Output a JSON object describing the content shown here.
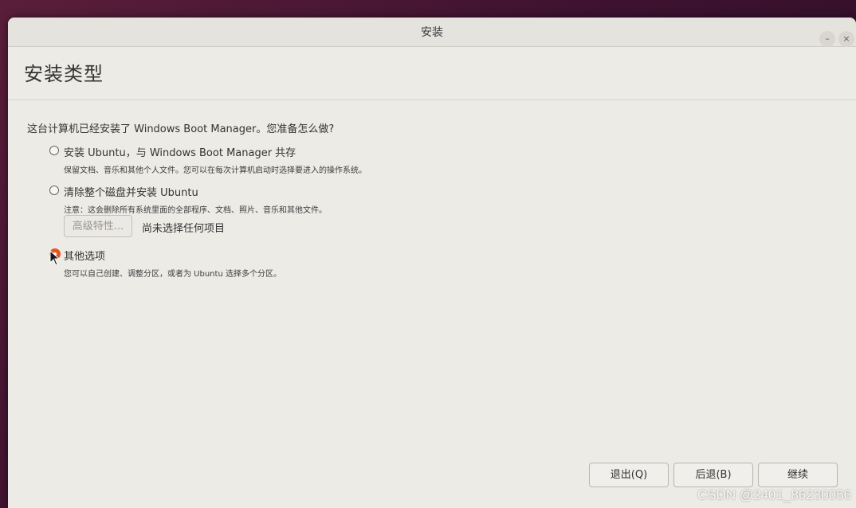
{
  "window": {
    "title": "安装",
    "minimize_glyph": "–",
    "close_glyph": "×"
  },
  "header": {
    "title": "安装类型"
  },
  "question": "这台计算机已经安装了 Windows Boot Manager。您准备怎么做?",
  "options": [
    {
      "label": "安装 Ubuntu，与 Windows Boot Manager 共存",
      "description": "保留文档、音乐和其他个人文件。您可以在每次计算机启动时选择要进入的操作系统。",
      "selected": false
    },
    {
      "label": "清除整个磁盘并安装 Ubuntu",
      "description": "注意：这会删除所有系统里面的全部程序、文档、照片、音乐和其他文件。",
      "selected": false
    },
    {
      "label": "其他选项",
      "description": "您可以自己创建、调整分区，或者为 Ubuntu 选择多个分区。",
      "selected": true
    }
  ],
  "advanced": {
    "button_label": "高级特性...",
    "status": "尚未选择任何项目"
  },
  "footer": {
    "quit_label": "退出(Q)",
    "back_label": "后退(B)",
    "continue_label": "继续"
  },
  "watermark": "CSDN @2401_86230056",
  "colors": {
    "accent": "#e95420",
    "window_bg": "#edebe6"
  },
  "icons": {
    "cursor": "mouse-pointer-icon"
  }
}
